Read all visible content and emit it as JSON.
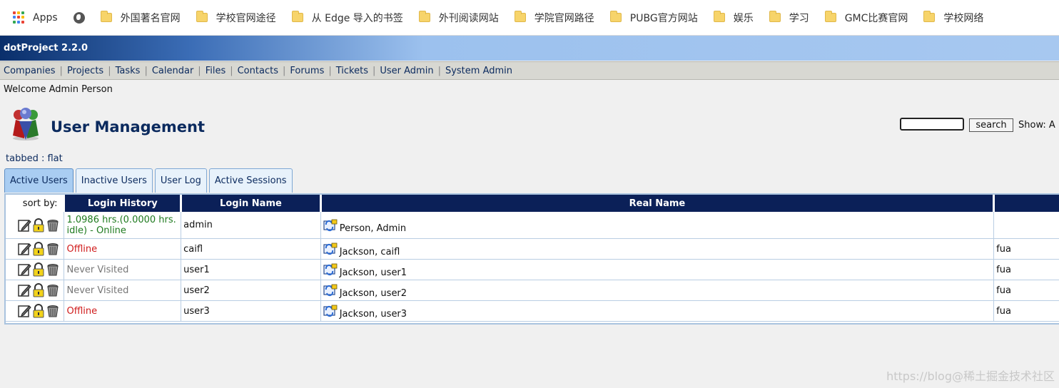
{
  "browser": {
    "apps_label": "Apps",
    "bookmarks": [
      "外国著名官网",
      "学校官网途径",
      "从 Edge 导入的书签",
      "外刊阅读网站",
      "学院官网路径",
      "PUBG官方网站",
      "娱乐",
      "学习",
      "GMC比赛官网",
      "学校网络"
    ]
  },
  "app": {
    "title": "dotProject 2.2.0",
    "nav": [
      "Companies",
      "Projects",
      "Tasks",
      "Calendar",
      "Files",
      "Contacts",
      "Forums",
      "Tickets",
      "User Admin",
      "System Admin"
    ],
    "welcome": "Welcome Admin Person"
  },
  "page": {
    "title": "User Management",
    "search_button": "search",
    "show_label": "Show: A",
    "view_tabbed": "tabbed",
    "view_sep": " : ",
    "view_flat": "flat"
  },
  "tabs": [
    "Active Users",
    "Inactive Users",
    "User Log",
    "Active Sessions"
  ],
  "table": {
    "sort_by": "sort by:",
    "headers": [
      "Login History",
      "Login Name",
      "Real Name"
    ],
    "rows": [
      {
        "history": "1.0986 hrs.(0.0000 hrs. idle) - Online",
        "status": "online",
        "login": "admin",
        "real": "Person, Admin",
        "company": ""
      },
      {
        "history": "Offline",
        "status": "offline",
        "login": "caifl",
        "real": "Jackson, caifl",
        "company": "fua"
      },
      {
        "history": "Never Visited",
        "status": "never",
        "login": "user1",
        "real": "Jackson, user1",
        "company": "fua"
      },
      {
        "history": "Never Visited",
        "status": "never",
        "login": "user2",
        "real": "Jackson, user2",
        "company": "fua"
      },
      {
        "history": "Offline",
        "status": "offline",
        "login": "user3",
        "real": "Jackson, user3",
        "company": "fua"
      }
    ]
  },
  "colors": {
    "status_online": "#1e7a1e",
    "status_offline": "#d01c1c",
    "status_never": "#777777",
    "header_bg": "#0b2058"
  },
  "icons": [
    "apps-grid-icon",
    "globe-icon",
    "folder-icon",
    "user-management-logo",
    "edit-icon",
    "lock-icon",
    "trash-icon",
    "user-permissions-icon"
  ],
  "watermark": "https://blog@稀土掘金技术社区"
}
